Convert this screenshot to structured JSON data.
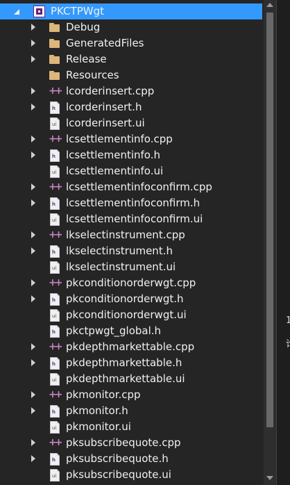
{
  "project": {
    "name": "PKCTPWgt",
    "expanded": true
  },
  "items": [
    {
      "label": "Debug",
      "type": "folder",
      "expandable": true
    },
    {
      "label": "GeneratedFiles",
      "type": "folder",
      "expandable": true
    },
    {
      "label": "Release",
      "type": "folder",
      "expandable": true
    },
    {
      "label": "Resources",
      "type": "folder",
      "expandable": false
    },
    {
      "label": "lcorderinsert.cpp",
      "type": "cpp",
      "expandable": true
    },
    {
      "label": "lcorderinsert.h",
      "type": "h",
      "expandable": true
    },
    {
      "label": "lcorderinsert.ui",
      "type": "ui",
      "expandable": false
    },
    {
      "label": "lcsettlementinfo.cpp",
      "type": "cpp",
      "expandable": true
    },
    {
      "label": "lcsettlementinfo.h",
      "type": "h",
      "expandable": true
    },
    {
      "label": "lcsettlementinfo.ui",
      "type": "ui",
      "expandable": false
    },
    {
      "label": "lcsettlementinfoconfirm.cpp",
      "type": "cpp",
      "expandable": true
    },
    {
      "label": "lcsettlementinfoconfirm.h",
      "type": "h",
      "expandable": true
    },
    {
      "label": "lcsettlementinfoconfirm.ui",
      "type": "ui",
      "expandable": false
    },
    {
      "label": "lkselectinstrument.cpp",
      "type": "cpp",
      "expandable": true
    },
    {
      "label": "lkselectinstrument.h",
      "type": "h",
      "expandable": true
    },
    {
      "label": "lkselectinstrument.ui",
      "type": "ui",
      "expandable": false
    },
    {
      "label": "pkconditionorderwgt.cpp",
      "type": "cpp",
      "expandable": true
    },
    {
      "label": "pkconditionorderwgt.h",
      "type": "h",
      "expandable": true
    },
    {
      "label": "pkconditionorderwgt.ui",
      "type": "ui",
      "expandable": false
    },
    {
      "label": "pkctpwgt_global.h",
      "type": "h",
      "expandable": false
    },
    {
      "label": "pkdepthmarkettable.cpp",
      "type": "cpp",
      "expandable": true
    },
    {
      "label": "pkdepthmarkettable.h",
      "type": "h",
      "expandable": true
    },
    {
      "label": "pkdepthmarkettable.ui",
      "type": "ui",
      "expandable": false
    },
    {
      "label": "pkmonitor.cpp",
      "type": "cpp",
      "expandable": true
    },
    {
      "label": "pkmonitor.h",
      "type": "h",
      "expandable": true
    },
    {
      "label": "pkmonitor.ui",
      "type": "ui",
      "expandable": false
    },
    {
      "label": "pksubscribequote.cpp",
      "type": "cpp",
      "expandable": true
    },
    {
      "label": "pksubscribequote.h",
      "type": "h",
      "expandable": true
    },
    {
      "label": "pksubscribequote.ui",
      "type": "ui",
      "expandable": false
    }
  ],
  "file_glyphs": {
    "h": "h",
    "ui": "ui",
    "cpp": "++"
  },
  "colors": {
    "selection": "#3399ff",
    "folder": "#dcb67a",
    "cpp_accent": "#c586c0",
    "project_accent": "#68217a"
  },
  "right_strip": {
    "peek_1": "1",
    "peek_2": "论"
  }
}
